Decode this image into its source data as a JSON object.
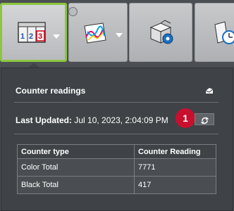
{
  "toolbar": {
    "tools": [
      {
        "name": "counter-tool",
        "digits": [
          "1",
          "2",
          "3"
        ],
        "active": true
      },
      {
        "name": "print-quality-tool",
        "active": false
      },
      {
        "name": "package-settings-tool",
        "active": false
      },
      {
        "name": "schedule-tool",
        "active": false
      }
    ]
  },
  "popup": {
    "title": "Counter readings",
    "updated_label": "Last Updated:",
    "updated_value": "Jul 10, 2023, 2:04:09 PM",
    "badge": "1",
    "table": {
      "headers": [
        "Counter type",
        "Counter Reading"
      ],
      "rows": [
        [
          "Color Total",
          "7771"
        ],
        [
          "Black Total",
          "417"
        ]
      ]
    }
  },
  "colors": {
    "accent": "#8cc63f",
    "badge": "#c8102e",
    "panel": "#3f4347"
  }
}
